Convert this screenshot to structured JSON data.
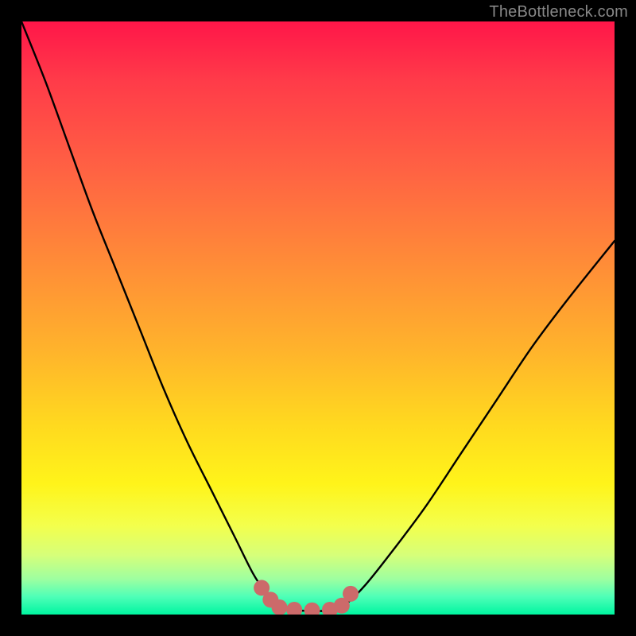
{
  "watermark": "TheBottleneck.com",
  "chart_data": {
    "type": "line",
    "title": "",
    "xlabel": "",
    "ylabel": "",
    "xlim": [
      0,
      100
    ],
    "ylim": [
      0,
      100
    ],
    "grid": false,
    "background_gradient": {
      "top_color": "#ff1649",
      "bottom_color": "#00f5a0",
      "stops": [
        "#ff1649",
        "#ff6243",
        "#ffb22c",
        "#fff41a",
        "#9effa0",
        "#00f5a0"
      ]
    },
    "series": [
      {
        "name": "curve",
        "color": "#000000",
        "x": [
          0,
          4,
          8,
          12,
          16,
          20,
          24,
          28,
          32,
          36,
          39,
          41,
          43,
          46,
          50,
          53,
          55,
          58,
          62,
          68,
          74,
          80,
          86,
          92,
          100
        ],
        "y": [
          100,
          90,
          79,
          68,
          58,
          48,
          38,
          29,
          21,
          13,
          7,
          4,
          2,
          0.8,
          0.6,
          0.8,
          2,
          5,
          10,
          18,
          27,
          36,
          45,
          53,
          63
        ]
      }
    ],
    "markers": {
      "name": "bottom-dots",
      "color": "#cc6a6a",
      "radius": 10,
      "points": [
        {
          "x": 40.5,
          "y": 4.5
        },
        {
          "x": 42.0,
          "y": 2.5
        },
        {
          "x": 43.5,
          "y": 1.2
        },
        {
          "x": 46.0,
          "y": 0.8
        },
        {
          "x": 49.0,
          "y": 0.7
        },
        {
          "x": 52.0,
          "y": 0.8
        },
        {
          "x": 54.0,
          "y": 1.5
        },
        {
          "x": 55.5,
          "y": 3.5
        }
      ]
    }
  }
}
